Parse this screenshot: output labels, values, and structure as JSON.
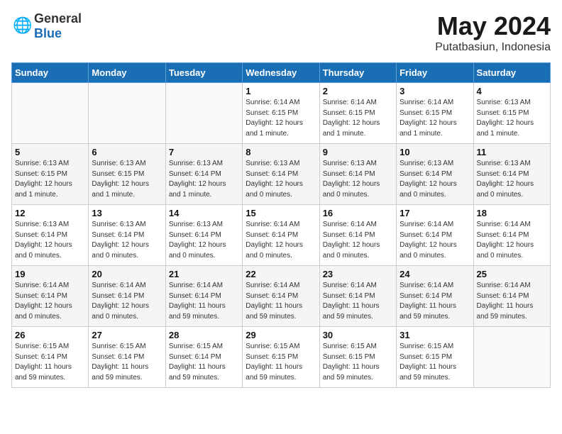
{
  "logo": {
    "general": "General",
    "blue": "Blue"
  },
  "title": "May 2024",
  "subtitle": "Putatbasiun, Indonesia",
  "days_of_week": [
    "Sunday",
    "Monday",
    "Tuesday",
    "Wednesday",
    "Thursday",
    "Friday",
    "Saturday"
  ],
  "weeks": [
    [
      {
        "day": "",
        "info": ""
      },
      {
        "day": "",
        "info": ""
      },
      {
        "day": "",
        "info": ""
      },
      {
        "day": "1",
        "info": "Sunrise: 6:14 AM\nSunset: 6:15 PM\nDaylight: 12 hours\nand 1 minute."
      },
      {
        "day": "2",
        "info": "Sunrise: 6:14 AM\nSunset: 6:15 PM\nDaylight: 12 hours\nand 1 minute."
      },
      {
        "day": "3",
        "info": "Sunrise: 6:14 AM\nSunset: 6:15 PM\nDaylight: 12 hours\nand 1 minute."
      },
      {
        "day": "4",
        "info": "Sunrise: 6:13 AM\nSunset: 6:15 PM\nDaylight: 12 hours\nand 1 minute."
      }
    ],
    [
      {
        "day": "5",
        "info": "Sunrise: 6:13 AM\nSunset: 6:15 PM\nDaylight: 12 hours\nand 1 minute."
      },
      {
        "day": "6",
        "info": "Sunrise: 6:13 AM\nSunset: 6:15 PM\nDaylight: 12 hours\nand 1 minute."
      },
      {
        "day": "7",
        "info": "Sunrise: 6:13 AM\nSunset: 6:14 PM\nDaylight: 12 hours\nand 1 minute."
      },
      {
        "day": "8",
        "info": "Sunrise: 6:13 AM\nSunset: 6:14 PM\nDaylight: 12 hours\nand 0 minutes."
      },
      {
        "day": "9",
        "info": "Sunrise: 6:13 AM\nSunset: 6:14 PM\nDaylight: 12 hours\nand 0 minutes."
      },
      {
        "day": "10",
        "info": "Sunrise: 6:13 AM\nSunset: 6:14 PM\nDaylight: 12 hours\nand 0 minutes."
      },
      {
        "day": "11",
        "info": "Sunrise: 6:13 AM\nSunset: 6:14 PM\nDaylight: 12 hours\nand 0 minutes."
      }
    ],
    [
      {
        "day": "12",
        "info": "Sunrise: 6:13 AM\nSunset: 6:14 PM\nDaylight: 12 hours\nand 0 minutes."
      },
      {
        "day": "13",
        "info": "Sunrise: 6:13 AM\nSunset: 6:14 PM\nDaylight: 12 hours\nand 0 minutes."
      },
      {
        "day": "14",
        "info": "Sunrise: 6:13 AM\nSunset: 6:14 PM\nDaylight: 12 hours\nand 0 minutes."
      },
      {
        "day": "15",
        "info": "Sunrise: 6:14 AM\nSunset: 6:14 PM\nDaylight: 12 hours\nand 0 minutes."
      },
      {
        "day": "16",
        "info": "Sunrise: 6:14 AM\nSunset: 6:14 PM\nDaylight: 12 hours\nand 0 minutes."
      },
      {
        "day": "17",
        "info": "Sunrise: 6:14 AM\nSunset: 6:14 PM\nDaylight: 12 hours\nand 0 minutes."
      },
      {
        "day": "18",
        "info": "Sunrise: 6:14 AM\nSunset: 6:14 PM\nDaylight: 12 hours\nand 0 minutes."
      }
    ],
    [
      {
        "day": "19",
        "info": "Sunrise: 6:14 AM\nSunset: 6:14 PM\nDaylight: 12 hours\nand 0 minutes."
      },
      {
        "day": "20",
        "info": "Sunrise: 6:14 AM\nSunset: 6:14 PM\nDaylight: 12 hours\nand 0 minutes."
      },
      {
        "day": "21",
        "info": "Sunrise: 6:14 AM\nSunset: 6:14 PM\nDaylight: 11 hours\nand 59 minutes."
      },
      {
        "day": "22",
        "info": "Sunrise: 6:14 AM\nSunset: 6:14 PM\nDaylight: 11 hours\nand 59 minutes."
      },
      {
        "day": "23",
        "info": "Sunrise: 6:14 AM\nSunset: 6:14 PM\nDaylight: 11 hours\nand 59 minutes."
      },
      {
        "day": "24",
        "info": "Sunrise: 6:14 AM\nSunset: 6:14 PM\nDaylight: 11 hours\nand 59 minutes."
      },
      {
        "day": "25",
        "info": "Sunrise: 6:14 AM\nSunset: 6:14 PM\nDaylight: 11 hours\nand 59 minutes."
      }
    ],
    [
      {
        "day": "26",
        "info": "Sunrise: 6:15 AM\nSunset: 6:14 PM\nDaylight: 11 hours\nand 59 minutes."
      },
      {
        "day": "27",
        "info": "Sunrise: 6:15 AM\nSunset: 6:14 PM\nDaylight: 11 hours\nand 59 minutes."
      },
      {
        "day": "28",
        "info": "Sunrise: 6:15 AM\nSunset: 6:14 PM\nDaylight: 11 hours\nand 59 minutes."
      },
      {
        "day": "29",
        "info": "Sunrise: 6:15 AM\nSunset: 6:15 PM\nDaylight: 11 hours\nand 59 minutes."
      },
      {
        "day": "30",
        "info": "Sunrise: 6:15 AM\nSunset: 6:15 PM\nDaylight: 11 hours\nand 59 minutes."
      },
      {
        "day": "31",
        "info": "Sunrise: 6:15 AM\nSunset: 6:15 PM\nDaylight: 11 hours\nand 59 minutes."
      },
      {
        "day": "",
        "info": ""
      }
    ]
  ]
}
